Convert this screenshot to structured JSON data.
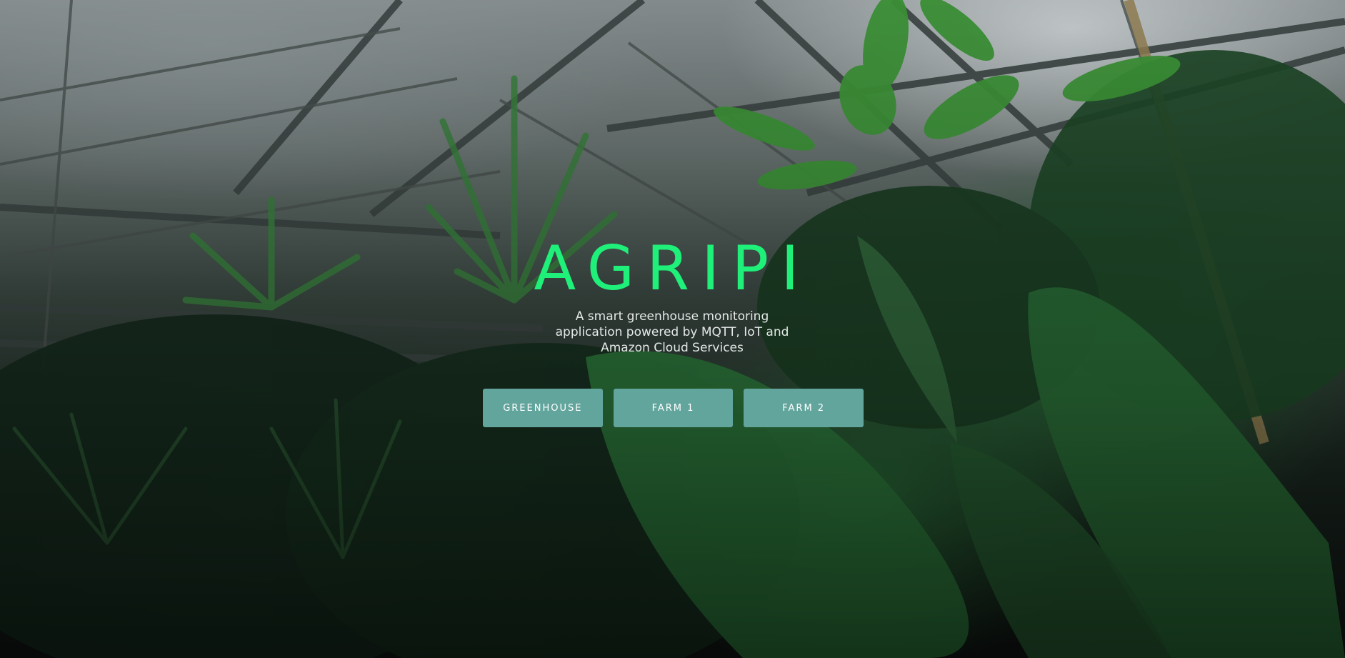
{
  "hero": {
    "title": "AGRIPI",
    "tagline_lines": [
      "A smart greenhouse monitoring",
      "application powered by MQTT, IoT and",
      "Amazon Cloud Services"
    ],
    "buttons": [
      {
        "label": "GREENHOUSE"
      },
      {
        "label": "FARM 1"
      },
      {
        "label": "FARM 2"
      }
    ]
  },
  "colors": {
    "title": "#1ff07a",
    "button_bg": "#62a59c",
    "button_text": "#ffffff",
    "tagline": "#e4e9e7"
  },
  "background": {
    "image_subject": "greenhouse-interior-with-plants"
  }
}
